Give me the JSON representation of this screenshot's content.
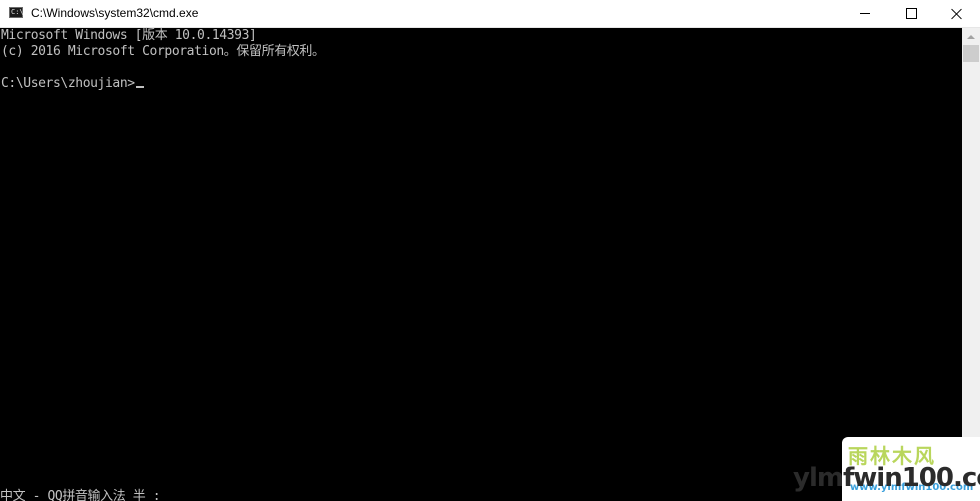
{
  "window": {
    "title": "C:\\Windows\\system32\\cmd.exe",
    "app_icon_glyph": "C:\\",
    "icons": {
      "app": "cmd-icon",
      "minimize": "minimize-icon",
      "maximize": "maximize-icon",
      "close": "close-icon"
    }
  },
  "console": {
    "lines": [
      "Microsoft Windows [版本 10.0.14393]",
      "(c) 2016 Microsoft Corporation。保留所有权利。",
      "C:\\Users\\zhoujian>"
    ],
    "ime_status": "中文 - QQ拼音输入法 半 :"
  },
  "watermark": {
    "badge_text": "雨林木风",
    "sub_text": "www.ylmfwin100.com",
    "domain": "ylmfwin100.com"
  },
  "colors": {
    "console_bg": "#000000",
    "console_text": "#c0c0c0",
    "titlebar_bg": "#ffffff",
    "scrollbar_bg": "#f0f0f0",
    "scroll_thumb": "#cdcdcd"
  }
}
